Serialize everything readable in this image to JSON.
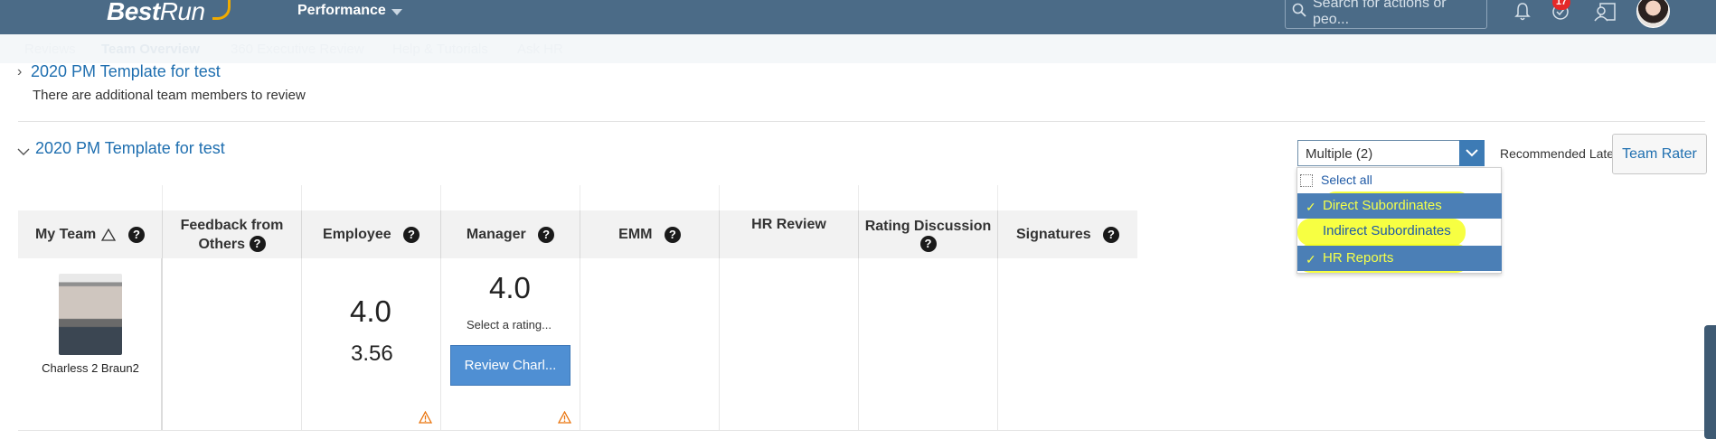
{
  "shell": {
    "logo_bold": "Best",
    "logo_run": "Run",
    "module": "Performance",
    "search_placeholder": "Search for actions or peo...",
    "notification_count": "17"
  },
  "tabs": [
    "Reviews",
    "Team Overview",
    "360 Executive Review",
    "Help & Tutorials",
    "Ask HR"
  ],
  "sections": {
    "collapsed_title": "2020 PM Template for test",
    "collapsed_note": "There are additional team members to review",
    "expanded_title": "2020 PM Template for test"
  },
  "filter": {
    "value": "Multiple (2)",
    "recommended_later": "Recommended Later",
    "team_rater": "Team Rater",
    "select_all": "Select all",
    "options": [
      {
        "label": "Direct Subordinates",
        "checked": true
      },
      {
        "label": "Indirect Subordinates",
        "checked": false
      },
      {
        "label": "HR Reports",
        "checked": true
      }
    ]
  },
  "columns": {
    "my_team": "My Team",
    "feedback": "Feedback from Others",
    "employee": "Employee",
    "manager": "Manager",
    "emm": "EMM",
    "hr_review": "HR Review",
    "rating_discussion": "Rating Discussion",
    "signatures": "Signatures"
  },
  "row": {
    "name": "Charless 2 Braun2",
    "employee_rating": "4.0",
    "employee_calc": "3.56",
    "manager_rating": "4.0",
    "manager_prompt": "Select a rating...",
    "review_button": "Review Charl..."
  },
  "colors": {
    "shell": "#4b6b87",
    "link": "#1f6fb0",
    "highlight": "#f6ff21",
    "warning": "#e9730c"
  }
}
